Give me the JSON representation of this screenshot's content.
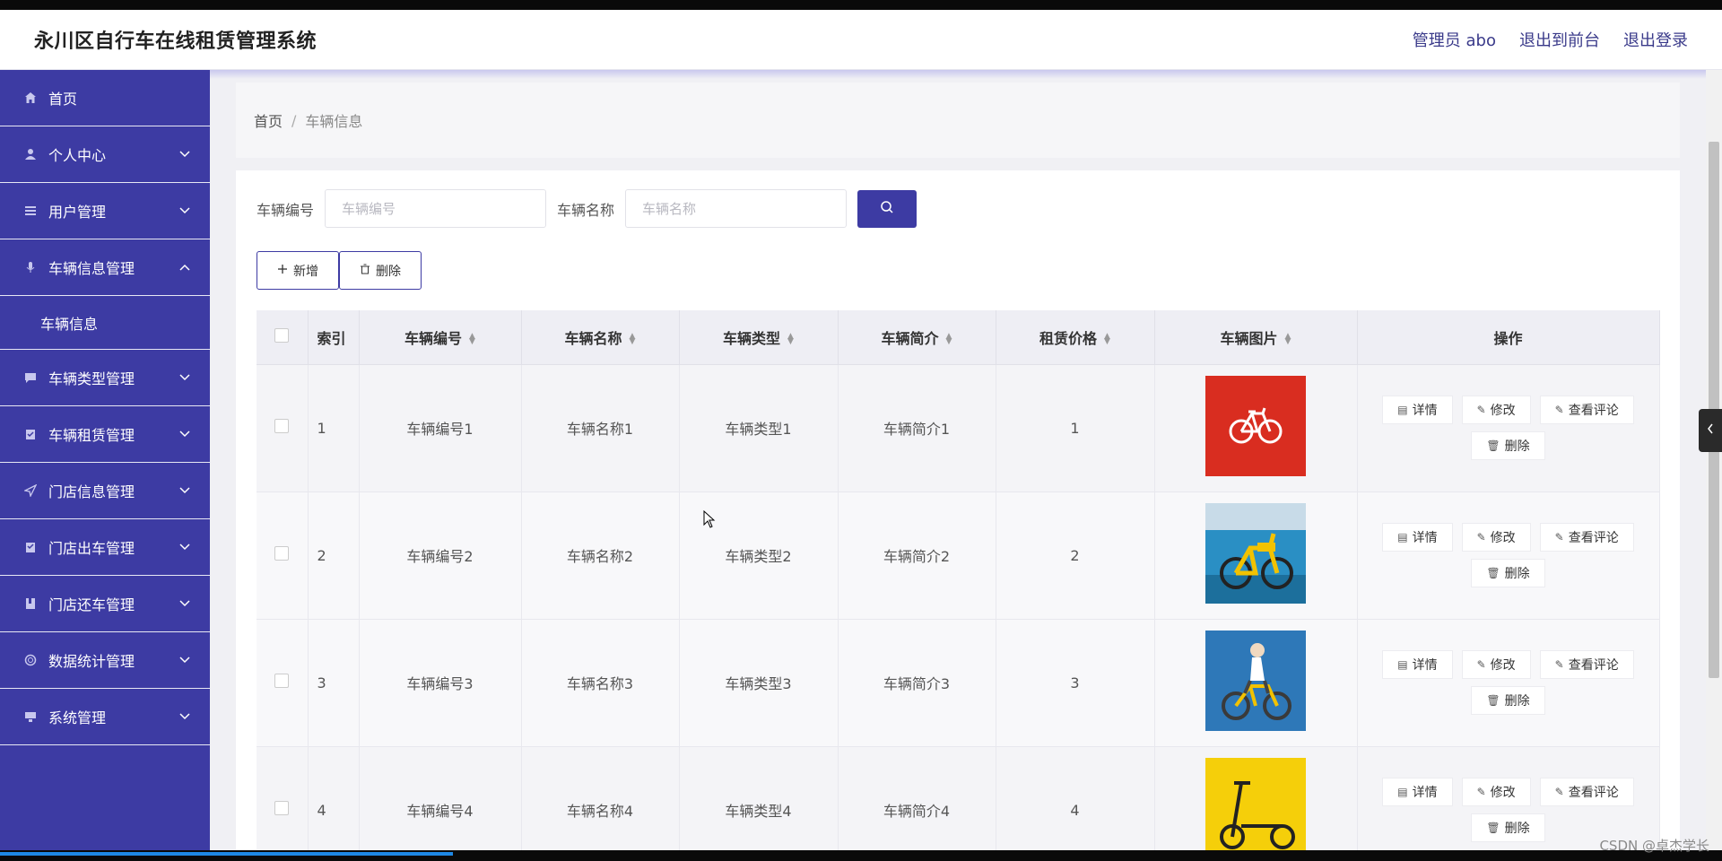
{
  "header": {
    "title": "永川区自行车在线租赁管理系统",
    "admin": "管理员 abo",
    "to_front": "退出到前台",
    "logout": "退出登录"
  },
  "sidebar": {
    "items": [
      {
        "label": "首页",
        "icon": "home-icon"
      },
      {
        "label": "个人中心",
        "icon": "user-icon"
      },
      {
        "label": "用户管理",
        "icon": "list-icon"
      },
      {
        "label": "车辆信息管理",
        "icon": "mic-icon",
        "expanded": true,
        "children": [
          "车辆信息"
        ]
      },
      {
        "label": "车辆类型管理",
        "icon": "chat-icon"
      },
      {
        "label": "车辆租赁管理",
        "icon": "clipboard-icon"
      },
      {
        "label": "门店信息管理",
        "icon": "send-icon"
      },
      {
        "label": "门店出车管理",
        "icon": "checklist-icon"
      },
      {
        "label": "门店还车管理",
        "icon": "bookmark-icon"
      },
      {
        "label": "数据统计管理",
        "icon": "circle-icon"
      },
      {
        "label": "系统管理",
        "icon": "monitor-icon"
      }
    ]
  },
  "breadcrumb": {
    "home": "首页",
    "separator": "/",
    "current": "车辆信息"
  },
  "search": {
    "code_label": "车辆编号",
    "code_placeholder": "车辆编号",
    "name_label": "车辆名称",
    "name_placeholder": "车辆名称"
  },
  "actions": {
    "add": "新增",
    "delete": "删除"
  },
  "table": {
    "headers": {
      "index": "索引",
      "code": "车辆编号",
      "name": "车辆名称",
      "type": "车辆类型",
      "intro": "车辆简介",
      "price": "租赁价格",
      "image": "车辆图片",
      "ops": "操作"
    },
    "rows": [
      {
        "index": "1",
        "code": "车辆编号1",
        "name": "车辆名称1",
        "type": "车辆类型1",
        "intro": "车辆简介1",
        "price": "1",
        "image": "red-bike"
      },
      {
        "index": "2",
        "code": "车辆编号2",
        "name": "车辆名称2",
        "type": "车辆类型2",
        "intro": "车辆简介2",
        "price": "2",
        "image": "yellow-bike"
      },
      {
        "index": "3",
        "code": "车辆编号3",
        "name": "车辆名称3",
        "type": "车辆类型3",
        "intro": "车辆简介3",
        "price": "3",
        "image": "rider-bike"
      },
      {
        "index": "4",
        "code": "车辆编号4",
        "name": "车辆名称4",
        "type": "车辆类型4",
        "intro": "车辆简介4",
        "price": "4",
        "image": "scooter"
      }
    ],
    "op_labels": {
      "detail": "详情",
      "edit": "修改",
      "comments": "查看评论",
      "delete": "删除"
    }
  },
  "watermark": "CSDN @卓杰学长",
  "colors": {
    "accent": "#3d3ba3",
    "header_bg": "#ffffff",
    "content_bg": "#f0f0f4"
  }
}
